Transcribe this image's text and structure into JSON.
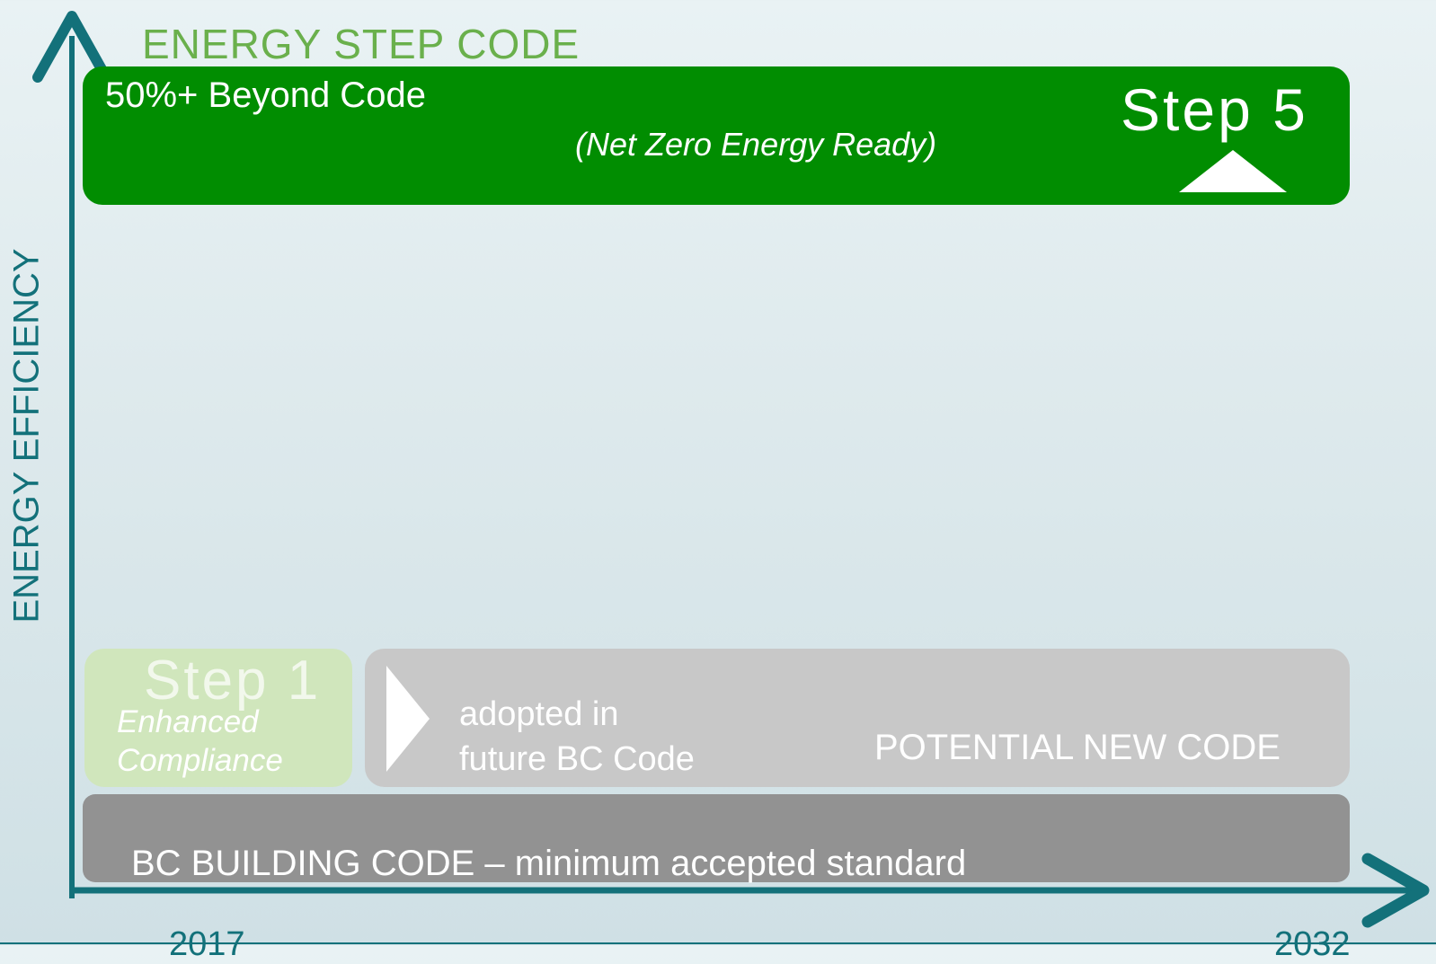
{
  "title": "ENERGY STEP CODE",
  "y_axis_label": "ENERGY EFFICIENCY",
  "x_axis": {
    "start_year": "2017",
    "end_year": "2032"
  },
  "step5": {
    "label": "Step 5",
    "description": "50%+ Beyond Code",
    "subtitle": "(Net Zero Energy Ready)"
  },
  "step1": {
    "label": "Step 1",
    "subtitle": "Enhanced\nCompliance"
  },
  "future": {
    "adopted_text": "adopted in\nfuture BC Code",
    "label": "POTENTIAL NEW CODE"
  },
  "baseline": {
    "label": "BC BUILDING CODE – minimum accepted standard"
  },
  "colors": {
    "axis": "#13717a",
    "title": "#6ab04c",
    "step5": "#018d01",
    "step1": "#d0e6bc",
    "future": "#c8c8c8",
    "baseline": "#929292",
    "background": "#e4eef1"
  }
}
